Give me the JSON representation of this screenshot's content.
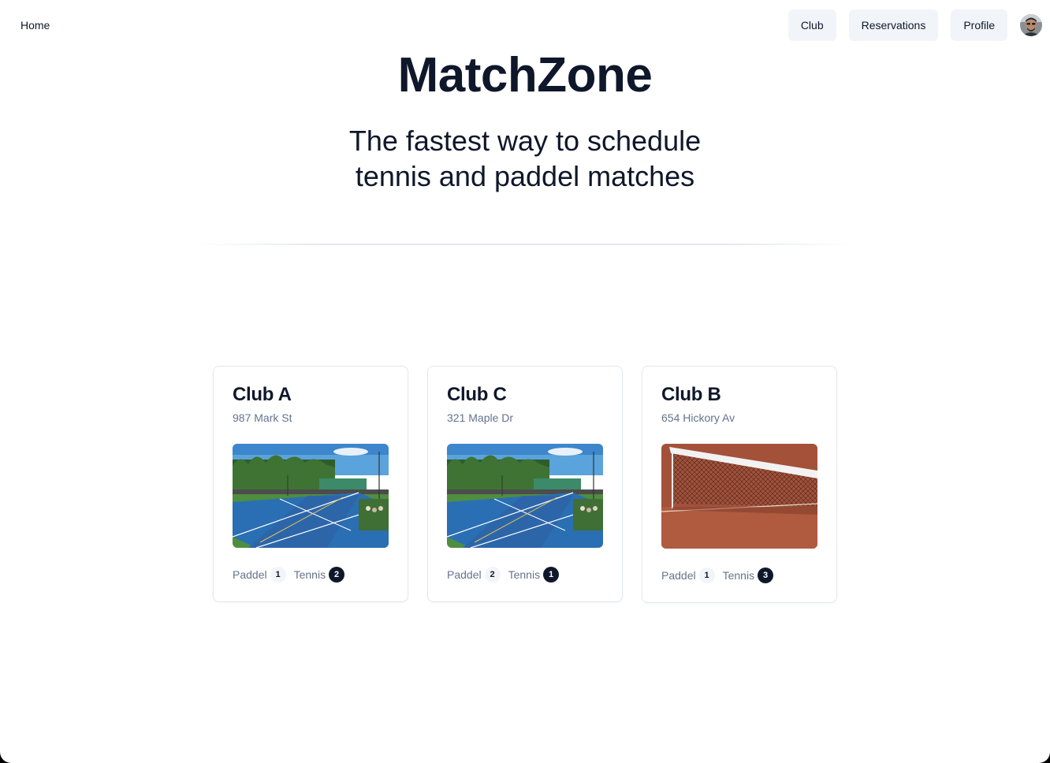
{
  "nav": {
    "home": "Home",
    "links": [
      "Club",
      "Reservations",
      "Profile"
    ]
  },
  "hero": {
    "title": "MatchZone",
    "subtitle_line1": "The fastest way to schedule",
    "subtitle_line2": "tennis and paddel matches"
  },
  "clubs": [
    {
      "name": "Club A",
      "address": "987 Mark St",
      "image": "tennis-courts-photo",
      "sports": [
        {
          "label": "Paddel",
          "count": "1"
        },
        {
          "label": "Tennis",
          "count": "2"
        }
      ]
    },
    {
      "name": "Club C",
      "address": "321 Maple Dr",
      "image": "tennis-courts-photo",
      "sports": [
        {
          "label": "Paddel",
          "count": "2"
        },
        {
          "label": "Tennis",
          "count": "1"
        }
      ]
    },
    {
      "name": "Club B",
      "address": "654 Hickory Av",
      "image": "clay-court-net-photo",
      "sports": [
        {
          "label": "Paddel",
          "count": "1"
        },
        {
          "label": "Tennis",
          "count": "3"
        }
      ]
    }
  ],
  "colors": {
    "text": "#0f172a",
    "muted": "#64748b",
    "button_bg": "#f1f5f9",
    "border": "#e2e8f0"
  }
}
